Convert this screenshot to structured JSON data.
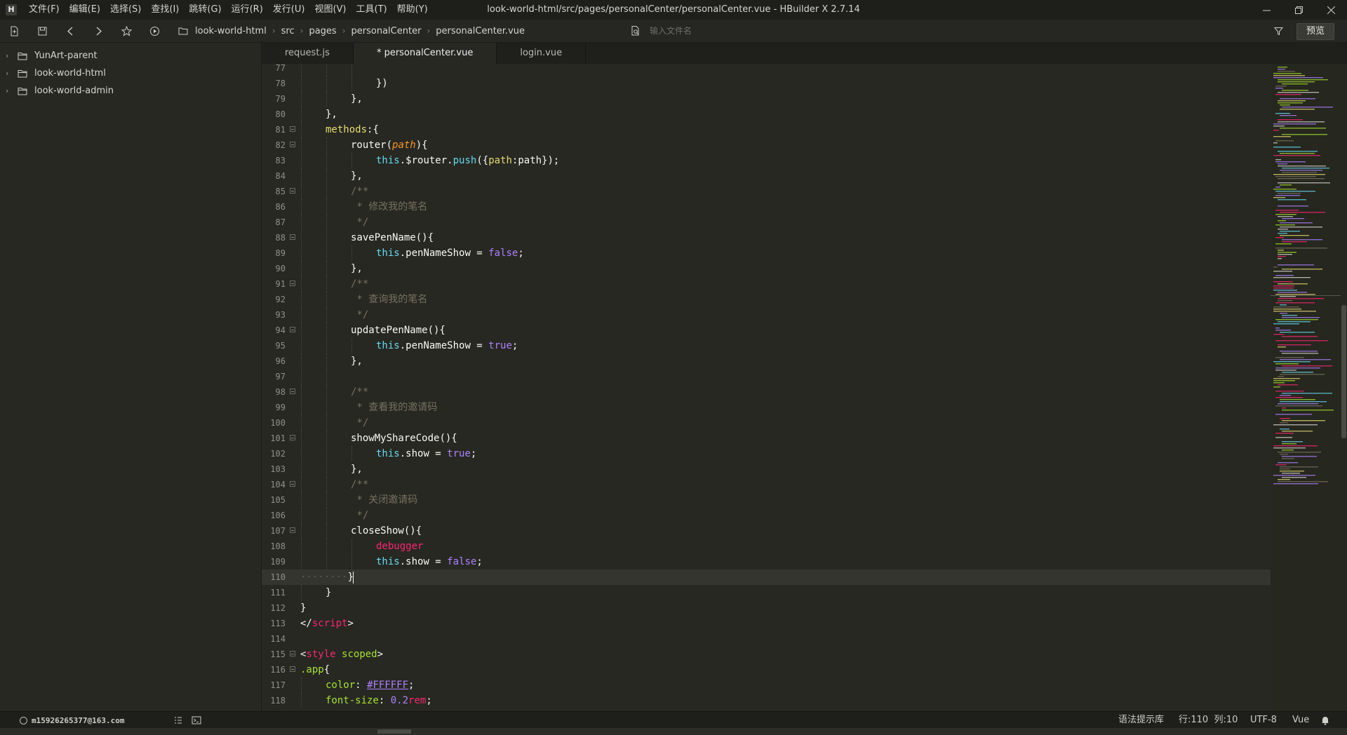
{
  "window": {
    "title": "look-world-html/src/pages/personalCenter/personalCenter.vue - HBuilder X 2.7.14",
    "logo_text": "H",
    "menu": [
      "文件(F)",
      "编辑(E)",
      "选择(S)",
      "查找(I)",
      "跳转(G)",
      "运行(R)",
      "发行(U)",
      "视图(V)",
      "工具(T)",
      "帮助(Y)"
    ]
  },
  "toolbar": {
    "breadcrumb": [
      "look-world-html",
      "src",
      "pages",
      "personalCenter",
      "personalCenter.vue"
    ],
    "search_placeholder": "输入文件名",
    "preview_label": "预览"
  },
  "sidebar": {
    "items": [
      "YunArt-parent",
      "look-world-html",
      "look-world-admin"
    ]
  },
  "tabs": [
    {
      "label": "request.js",
      "active": false
    },
    {
      "label": "* personalCenter.vue",
      "active": true
    },
    {
      "label": "login.vue",
      "active": false
    }
  ],
  "editor": {
    "current_line": 110,
    "lines": [
      {
        "n": "77",
        "indent": 3,
        "fold": false,
        "tokens": []
      },
      {
        "n": "78",
        "indent": 3,
        "fold": false,
        "tokens": [
          [
            "p",
            "})"
          ]
        ]
      },
      {
        "n": "79",
        "indent": 2,
        "fold": false,
        "tokens": [
          [
            "p",
            "},"
          ]
        ]
      },
      {
        "n": "80",
        "indent": 1,
        "fold": false,
        "tokens": [
          [
            "p",
            "},"
          ]
        ]
      },
      {
        "n": "81",
        "indent": 1,
        "fold": true,
        "tokens": [
          [
            "key",
            "methods"
          ],
          [
            "p",
            ":{"
          ]
        ]
      },
      {
        "n": "82",
        "indent": 2,
        "fold": true,
        "tokens": [
          [
            "fn",
            "router"
          ],
          [
            "p",
            "("
          ],
          [
            "param",
            "path"
          ],
          [
            "p",
            "){"
          ]
        ]
      },
      {
        "n": "83",
        "indent": 3,
        "fold": false,
        "tokens": [
          [
            "this",
            "this"
          ],
          [
            "p",
            "."
          ],
          [
            "fn",
            "$router"
          ],
          [
            "p",
            "."
          ],
          [
            "method",
            "push"
          ],
          [
            "p",
            "({"
          ],
          [
            "key",
            "path"
          ],
          [
            "p",
            ":path});"
          ]
        ]
      },
      {
        "n": "84",
        "indent": 2,
        "fold": false,
        "tokens": [
          [
            "p",
            "},"
          ]
        ]
      },
      {
        "n": "85",
        "indent": 2,
        "fold": true,
        "tokens": [
          [
            "comment",
            "/**"
          ]
        ]
      },
      {
        "n": "86",
        "indent": 2,
        "fold": false,
        "tokens": [
          [
            "comment",
            " * 修改我的笔名"
          ]
        ]
      },
      {
        "n": "87",
        "indent": 2,
        "fold": false,
        "tokens": [
          [
            "comment",
            " */"
          ]
        ]
      },
      {
        "n": "88",
        "indent": 2,
        "fold": true,
        "tokens": [
          [
            "fn",
            "savePenName"
          ],
          [
            "p",
            "(){"
          ]
        ]
      },
      {
        "n": "89",
        "indent": 3,
        "fold": false,
        "tokens": [
          [
            "this",
            "this"
          ],
          [
            "p",
            "."
          ],
          [
            "fn",
            "penNameShow"
          ],
          [
            "p",
            " = "
          ],
          [
            "bool",
            "false"
          ],
          [
            "p",
            ";"
          ]
        ]
      },
      {
        "n": "90",
        "indent": 2,
        "fold": false,
        "tokens": [
          [
            "p",
            "},"
          ]
        ]
      },
      {
        "n": "91",
        "indent": 2,
        "fold": true,
        "tokens": [
          [
            "comment",
            "/**"
          ]
        ]
      },
      {
        "n": "92",
        "indent": 2,
        "fold": false,
        "tokens": [
          [
            "comment",
            " * 查询我的笔名"
          ]
        ]
      },
      {
        "n": "93",
        "indent": 2,
        "fold": false,
        "tokens": [
          [
            "comment",
            " */"
          ]
        ]
      },
      {
        "n": "94",
        "indent": 2,
        "fold": true,
        "tokens": [
          [
            "fn",
            "updatePenName"
          ],
          [
            "p",
            "(){"
          ]
        ]
      },
      {
        "n": "95",
        "indent": 3,
        "fold": false,
        "tokens": [
          [
            "this",
            "this"
          ],
          [
            "p",
            "."
          ],
          [
            "fn",
            "penNameShow"
          ],
          [
            "p",
            " = "
          ],
          [
            "bool",
            "true"
          ],
          [
            "p",
            ";"
          ]
        ]
      },
      {
        "n": "96",
        "indent": 2,
        "fold": false,
        "tokens": [
          [
            "p",
            "},"
          ]
        ]
      },
      {
        "n": "97",
        "indent": 2,
        "fold": false,
        "tokens": []
      },
      {
        "n": "98",
        "indent": 2,
        "fold": true,
        "tokens": [
          [
            "comment",
            "/**"
          ]
        ]
      },
      {
        "n": "99",
        "indent": 2,
        "fold": false,
        "tokens": [
          [
            "comment",
            " * 查看我的邀请码"
          ]
        ]
      },
      {
        "n": "100",
        "indent": 2,
        "fold": false,
        "tokens": [
          [
            "comment",
            " */"
          ]
        ]
      },
      {
        "n": "101",
        "indent": 2,
        "fold": true,
        "tokens": [
          [
            "fn",
            "showMyShareCode"
          ],
          [
            "p",
            "(){"
          ]
        ]
      },
      {
        "n": "102",
        "indent": 3,
        "fold": false,
        "tokens": [
          [
            "this",
            "this"
          ],
          [
            "p",
            "."
          ],
          [
            "fn",
            "show"
          ],
          [
            "p",
            " = "
          ],
          [
            "bool",
            "true"
          ],
          [
            "p",
            ";"
          ]
        ]
      },
      {
        "n": "103",
        "indent": 2,
        "fold": false,
        "tokens": [
          [
            "p",
            "},"
          ]
        ]
      },
      {
        "n": "104",
        "indent": 2,
        "fold": true,
        "tokens": [
          [
            "comment",
            "/**"
          ]
        ]
      },
      {
        "n": "105",
        "indent": 2,
        "fold": false,
        "tokens": [
          [
            "comment",
            " * 关闭邀请码"
          ]
        ]
      },
      {
        "n": "106",
        "indent": 2,
        "fold": false,
        "tokens": [
          [
            "comment",
            " */"
          ]
        ]
      },
      {
        "n": "107",
        "indent": 2,
        "fold": true,
        "tokens": [
          [
            "fn",
            "closeShow"
          ],
          [
            "p",
            "(){"
          ]
        ]
      },
      {
        "n": "108",
        "indent": 3,
        "fold": false,
        "tokens": [
          [
            "debugger",
            "debugger"
          ]
        ]
      },
      {
        "n": "109",
        "indent": 3,
        "fold": false,
        "tokens": [
          [
            "this",
            "this"
          ],
          [
            "p",
            "."
          ],
          [
            "fn",
            "show"
          ],
          [
            "p",
            " = "
          ],
          [
            "bool",
            "false"
          ],
          [
            "p",
            ";"
          ]
        ]
      },
      {
        "n": "110",
        "indent": 0,
        "fold": false,
        "tokens": [
          [
            "dots",
            "········"
          ],
          [
            "p",
            "}"
          ],
          [
            "cursor",
            ""
          ]
        ]
      },
      {
        "n": "111",
        "indent": 1,
        "fold": false,
        "tokens": [
          [
            "p",
            "}"
          ]
        ]
      },
      {
        "n": "112",
        "indent": 0,
        "fold": false,
        "tokens": [
          [
            "p",
            "}"
          ]
        ]
      },
      {
        "n": "113",
        "indent": 0,
        "fold": false,
        "tokens": [
          [
            "p",
            "</"
          ],
          [
            "tag",
            "script"
          ],
          [
            "p",
            ">"
          ]
        ]
      },
      {
        "n": "114",
        "indent": 0,
        "fold": false,
        "tokens": []
      },
      {
        "n": "115",
        "indent": 0,
        "fold": true,
        "tokens": [
          [
            "p",
            "<"
          ],
          [
            "tag",
            "style"
          ],
          [
            "p",
            " "
          ],
          [
            "attr",
            "scoped"
          ],
          [
            "p",
            ">"
          ]
        ]
      },
      {
        "n": "116",
        "indent": 0,
        "fold": true,
        "tokens": [
          [
            "sel",
            ".app"
          ],
          [
            "p",
            "{"
          ]
        ]
      },
      {
        "n": "117",
        "indent": 1,
        "fold": false,
        "tokens": [
          [
            "prop",
            "color"
          ],
          [
            "p",
            ": "
          ],
          [
            "color",
            "#FFFFFF"
          ],
          [
            "p",
            ";"
          ]
        ]
      },
      {
        "n": "118",
        "indent": 1,
        "fold": false,
        "tokens": [
          [
            "prop",
            "font-size"
          ],
          [
            "p",
            ": "
          ],
          [
            "num",
            "0.2"
          ],
          [
            "unit",
            "rem"
          ],
          [
            "p",
            ";"
          ]
        ]
      }
    ]
  },
  "statusbar": {
    "account": "m15926265377@163.com",
    "syntax_hint": "语法提示库",
    "position": "行:110  列:10",
    "encoding": "UTF-8",
    "language": "Vue"
  },
  "colors": {
    "background": "#272822",
    "accent_keyword": "#f92672",
    "accent_string": "#e6db74",
    "accent_function": "#66d9ef"
  }
}
